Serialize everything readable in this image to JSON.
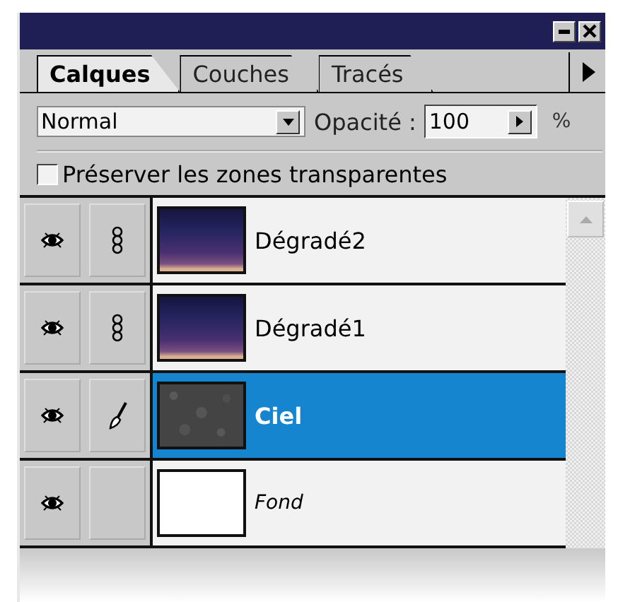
{
  "tabs": [
    {
      "label": "Calques",
      "selected": true
    },
    {
      "label": "Couches",
      "selected": false
    },
    {
      "label": "Tracés",
      "selected": false
    }
  ],
  "blend_mode": {
    "value": "Normal"
  },
  "opacity": {
    "label": "Opacité :",
    "value": "100",
    "unit": "%"
  },
  "preserve_transparency": {
    "label": "Préserver les zones transparentes",
    "checked": false
  },
  "layers": [
    {
      "kind": "gradient",
      "name": "Dégradé2",
      "visible": true,
      "linked": true,
      "painting": false,
      "selected": false,
      "background": false
    },
    {
      "kind": "gradient",
      "name": "Dégradé1",
      "visible": true,
      "linked": true,
      "painting": false,
      "selected": false,
      "background": false
    },
    {
      "kind": "noise",
      "name": "Ciel",
      "visible": true,
      "linked": false,
      "painting": true,
      "selected": true,
      "background": false
    },
    {
      "kind": "white",
      "name": "Fond",
      "visible": true,
      "linked": false,
      "painting": false,
      "selected": false,
      "background": true
    }
  ]
}
